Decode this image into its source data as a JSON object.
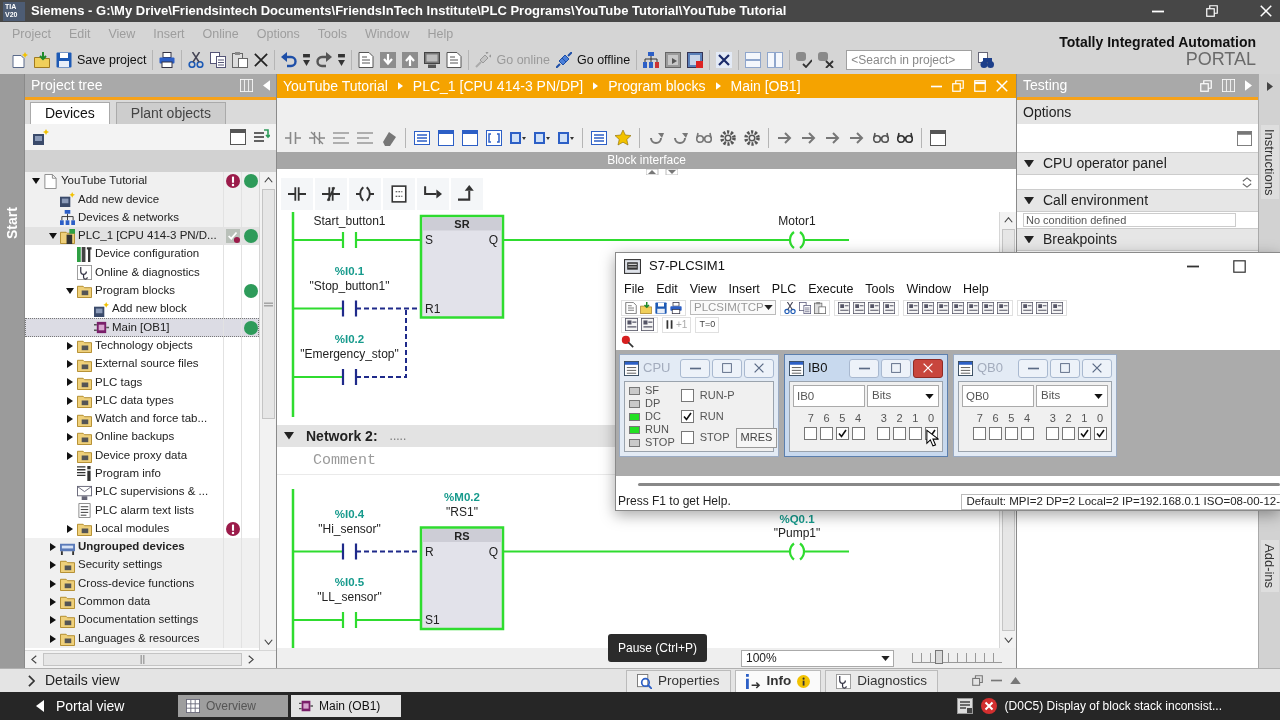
{
  "window": {
    "logo": [
      "TIA",
      "V20"
    ],
    "title": "Siemens - G:\\My Drive\\Friendsintech Documents\\FriendsInTech Institute\\PLC Programs\\YouTube Tutorial\\YouTube Tutorial"
  },
  "menu": [
    {
      "label": "Project",
      "disabled": true
    },
    {
      "label": "Edit",
      "disabled": true
    },
    {
      "label": "View",
      "disabled": true
    },
    {
      "label": "Insert",
      "disabled": true
    },
    {
      "label": "Online",
      "disabled": true
    },
    {
      "label": "Options",
      "disabled": true
    },
    {
      "label": "Tools",
      "disabled": true
    },
    {
      "label": "Window",
      "disabled": true
    },
    {
      "label": "Help",
      "disabled": true
    }
  ],
  "toolbar": {
    "save_label": "Save project",
    "go_online": {
      "label": "Go online",
      "disabled": true
    },
    "go_offline": {
      "label": "Go offline",
      "disabled": false
    },
    "search": {
      "placeholder": "<Search in project>"
    }
  },
  "brand": {
    "line_1": "Totally Integrated Automation",
    "line_2": "PORTAL"
  },
  "start_tab": "Start",
  "project_tree": {
    "title": "Project tree",
    "tabs": [
      {
        "label": "Devices",
        "selected": true
      },
      {
        "label": "Plant objects",
        "selected": false
      }
    ],
    "items": [
      {
        "label": "YouTube Tutorial",
        "kind": "project",
        "expanded": true,
        "selected": false,
        "error": true,
        "compare": false,
        "online": true,
        "children": [
          {
            "label": "Add new device",
            "kind": "add",
            "selected": false,
            "error": false,
            "compare": false,
            "online": false
          },
          {
            "label": "Devices & networks",
            "kind": "network",
            "selected": false,
            "error": false,
            "compare": false,
            "online": false
          },
          {
            "label": "PLC_1 [CPU 414-3 PN/D...",
            "kind": "plc",
            "expanded": true,
            "selected": false,
            "error": false,
            "compare": true,
            "online": true,
            "children": [
              {
                "label": "Device configuration",
                "kind": "config",
                "selected": false,
                "error": false,
                "compare": false,
                "online": false
              },
              {
                "label": "Online & diagnostics",
                "kind": "diagnostics",
                "selected": false,
                "error": false,
                "compare": false,
                "online": false
              },
              {
                "label": "Program blocks",
                "kind": "folder",
                "expanded": true,
                "selected": false,
                "error": false,
                "compare": false,
                "online": true,
                "children": [
                  {
                    "label": "Add new block",
                    "kind": "add",
                    "selected": false,
                    "error": false,
                    "compare": false,
                    "online": false
                  },
                  {
                    "label": "Main [OB1]",
                    "kind": "block",
                    "selected": true,
                    "error": false,
                    "compare": false,
                    "online": true
                  }
                ]
              },
              {
                "label": "Technology objects",
                "kind": "folder",
                "expanded": false,
                "selected": false,
                "error": false,
                "compare": false,
                "online": false
              },
              {
                "label": "External source files",
                "kind": "folder",
                "expanded": false,
                "selected": false,
                "error": false,
                "compare": false,
                "online": false
              },
              {
                "label": "PLC tags",
                "kind": "folder",
                "expanded": false,
                "selected": false,
                "error": false,
                "compare": false,
                "online": false
              },
              {
                "label": "PLC data types",
                "kind": "folder",
                "expanded": false,
                "selected": false,
                "error": false,
                "compare": false,
                "online": false
              },
              {
                "label": "Watch and force tab...",
                "kind": "folder",
                "expanded": false,
                "selected": false,
                "error": false,
                "compare": false,
                "online": false
              },
              {
                "label": "Online backups",
                "kind": "folder",
                "expanded": false,
                "selected": false,
                "error": false,
                "compare": false,
                "online": false
              },
              {
                "label": "Device proxy data",
                "kind": "folder",
                "expanded": false,
                "selected": false,
                "error": false,
                "compare": false,
                "online": false
              },
              {
                "label": "Program info",
                "kind": "info",
                "selected": false,
                "error": false,
                "compare": false,
                "online": false
              },
              {
                "label": "PLC supervisions & ...",
                "kind": "supervision",
                "selected": false,
                "error": false,
                "compare": false,
                "online": false
              },
              {
                "label": "PLC alarm text lists",
                "kind": "textlist",
                "selected": false,
                "error": false,
                "compare": false,
                "online": false
              },
              {
                "label": "Local modules",
                "kind": "folder",
                "expanded": false,
                "selected": false,
                "error": true,
                "compare": false,
                "online": false
              }
            ]
          },
          {
            "label": "Ungrouped devices",
            "kind": "group",
            "expanded": false,
            "selected": false,
            "error": false,
            "compare": false,
            "online": false
          },
          {
            "label": "Security settings",
            "kind": "folder",
            "expanded": false,
            "selected": false,
            "error": false,
            "compare": false,
            "online": false
          },
          {
            "label": "Cross-device functions",
            "kind": "folder",
            "expanded": false,
            "selected": false,
            "error": false,
            "compare": false,
            "online": false
          },
          {
            "label": "Common data",
            "kind": "folder",
            "expanded": false,
            "selected": false,
            "error": false,
            "compare": false,
            "online": false
          },
          {
            "label": "Documentation settings",
            "kind": "folder",
            "expanded": false,
            "selected": false,
            "error": false,
            "compare": false,
            "online": false
          },
          {
            "label": "Languages & resources",
            "kind": "folder",
            "expanded": false,
            "selected": false,
            "error": false,
            "compare": false,
            "online": false
          }
        ]
      }
    ]
  },
  "editor": {
    "breadcrumb": [
      "YouTube Tutorial",
      "PLC_1 [CPU 414-3 PN/DP]",
      "Program blocks",
      "Main [OB1]"
    ],
    "block_interface": "Block interface",
    "network_1": {
      "inputs": [
        {
          "pin": "S",
          "contacts": [
            {
              "operand": "Start_button1",
              "powered": true
            }
          ]
        },
        {
          "pin": "R1",
          "contacts": [
            {
              "address": "%I0.1",
              "operand": "\"Stop_button1\"",
              "powered": false
            },
            {
              "address": "%I0.2",
              "operand": "\"Emergency_stop\"",
              "powered": false
            }
          ]
        }
      ],
      "box": {
        "type": "SR",
        "output": "Q",
        "powered": true
      },
      "coil": {
        "operand": "Motor1",
        "powered": true
      }
    },
    "network_2": {
      "title": "Network 2:",
      "dots": ".....",
      "expanded": true,
      "comment_placeholder": "Comment",
      "inputs": [
        {
          "pin": "R",
          "contacts": [
            {
              "address": "%I0.4",
              "operand": "\"Hi_sensor\"",
              "powered": false
            }
          ]
        },
        {
          "pin": "S1",
          "contacts": [
            {
              "address": "%I0.5",
              "operand": "\"LL_sensor\"",
              "powered": true
            }
          ]
        }
      ],
      "box": {
        "address": "%M0.2",
        "operand": "\"RS1\"",
        "type": "RS",
        "output": "Q",
        "powered": true
      },
      "coil": {
        "address": "%Q0.1",
        "operand": "\"Pump1\"",
        "powered": true
      }
    },
    "zoom": "100%",
    "zoom_slider": {
      "level": 0.3
    }
  },
  "testing": {
    "title": "Testing",
    "options": "Options",
    "sections": [
      {
        "label": "CPU operator panel",
        "expanded": true
      },
      {
        "label": "Call environment",
        "expanded": true,
        "field": "No condition defined"
      },
      {
        "label": "Breakpoints",
        "expanded": true
      }
    ]
  },
  "side_tabs": [
    "Instructions",
    "Add-ins"
  ],
  "plcsim": {
    "title": "S7-PLCSIM1",
    "menu": [
      "File",
      "Edit",
      "View",
      "Insert",
      "PLC",
      "Execute",
      "Tools",
      "Window",
      "Help"
    ],
    "connection": {
      "value": "PLCSIM(TCP",
      "disabled": true
    },
    "step": {
      "label": "+1",
      "disabled": true
    },
    "timer": "T=0",
    "windows": [
      {
        "kind": "cpu",
        "title": "CPU",
        "active": false,
        "leds": [
          {
            "label": "SF",
            "on": false
          },
          {
            "label": "DP",
            "on": false
          },
          {
            "label": "DC",
            "on": true
          },
          {
            "label": "RUN",
            "on": true
          },
          {
            "label": "STOP",
            "on": false
          }
        ],
        "modes": [
          {
            "label": "RUN-P",
            "checked": false
          },
          {
            "label": "RUN",
            "checked": true
          },
          {
            "label": "STOP",
            "checked": false
          }
        ],
        "button": "MRES"
      },
      {
        "kind": "bits",
        "title": "IB0",
        "active": true,
        "address": "IB0",
        "format": "Bits",
        "bits": [
          {
            "label": "7",
            "checked": false
          },
          {
            "label": "6",
            "checked": false
          },
          {
            "label": "5",
            "checked": true
          },
          {
            "label": "4",
            "checked": false
          },
          {
            "label": "3",
            "checked": false
          },
          {
            "label": "2",
            "checked": false
          },
          {
            "label": "1",
            "checked": false
          },
          {
            "label": "0",
            "checked": true
          }
        ]
      },
      {
        "kind": "bits",
        "title": "QB0",
        "active": false,
        "address": "QB0",
        "format": "Bits",
        "bits": [
          {
            "label": "7",
            "checked": false
          },
          {
            "label": "6",
            "checked": false
          },
          {
            "label": "5",
            "checked": false
          },
          {
            "label": "4",
            "checked": false
          },
          {
            "label": "3",
            "checked": false
          },
          {
            "label": "2",
            "checked": false
          },
          {
            "label": "1",
            "checked": true
          },
          {
            "label": "0",
            "checked": true
          }
        ]
      }
    ],
    "status": "Press F1 to get Help.",
    "status_right": "Default: MPI=2 DP=2 Local=2 IP=192.168.0.1 ISO=08-00-12-"
  },
  "tooltip": "Pause (Ctrl+P)",
  "details_view": "Details view",
  "inspector_tabs": [
    {
      "label": "Properties",
      "selected": false
    },
    {
      "label": "Info",
      "selected": true
    },
    {
      "label": "Diagnostics",
      "selected": false
    }
  ],
  "taskbar": {
    "portal_view": "Portal view",
    "tabs": [
      {
        "label": "Overview",
        "selected": false
      },
      {
        "label": "Main (OB1)",
        "selected": true
      }
    ],
    "message": "(D0C5) Display of block stack inconsist..."
  }
}
